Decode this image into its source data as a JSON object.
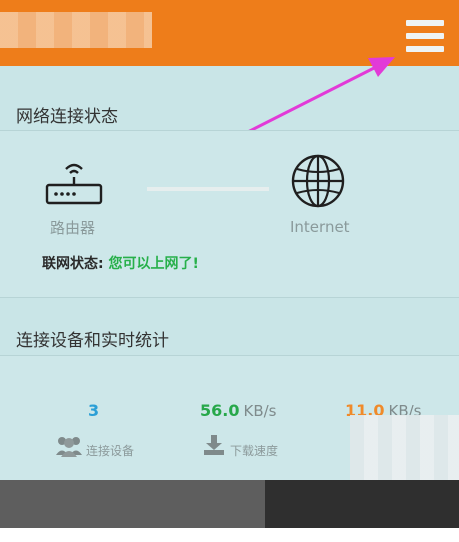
{
  "header": {
    "menu_icon": "hamburger-menu-icon",
    "accent_color": "#ee7d1a"
  },
  "network_status": {
    "title": "网络连接状态",
    "router_label": "路由器",
    "internet_label": "Internet",
    "status_key": "联网状态:",
    "status_value": "您可以上网了!"
  },
  "realtime": {
    "title": "连接设备和实时统计",
    "devices": {
      "value": "3",
      "label": "连接设备",
      "color": "#2b9fd6"
    },
    "download": {
      "value": "56.0",
      "unit": "KB/s",
      "label": "下载速度",
      "color": "#27a84a"
    },
    "upload": {
      "value": "11.0",
      "unit": "KB/s",
      "color": "#f08a2a"
    }
  }
}
